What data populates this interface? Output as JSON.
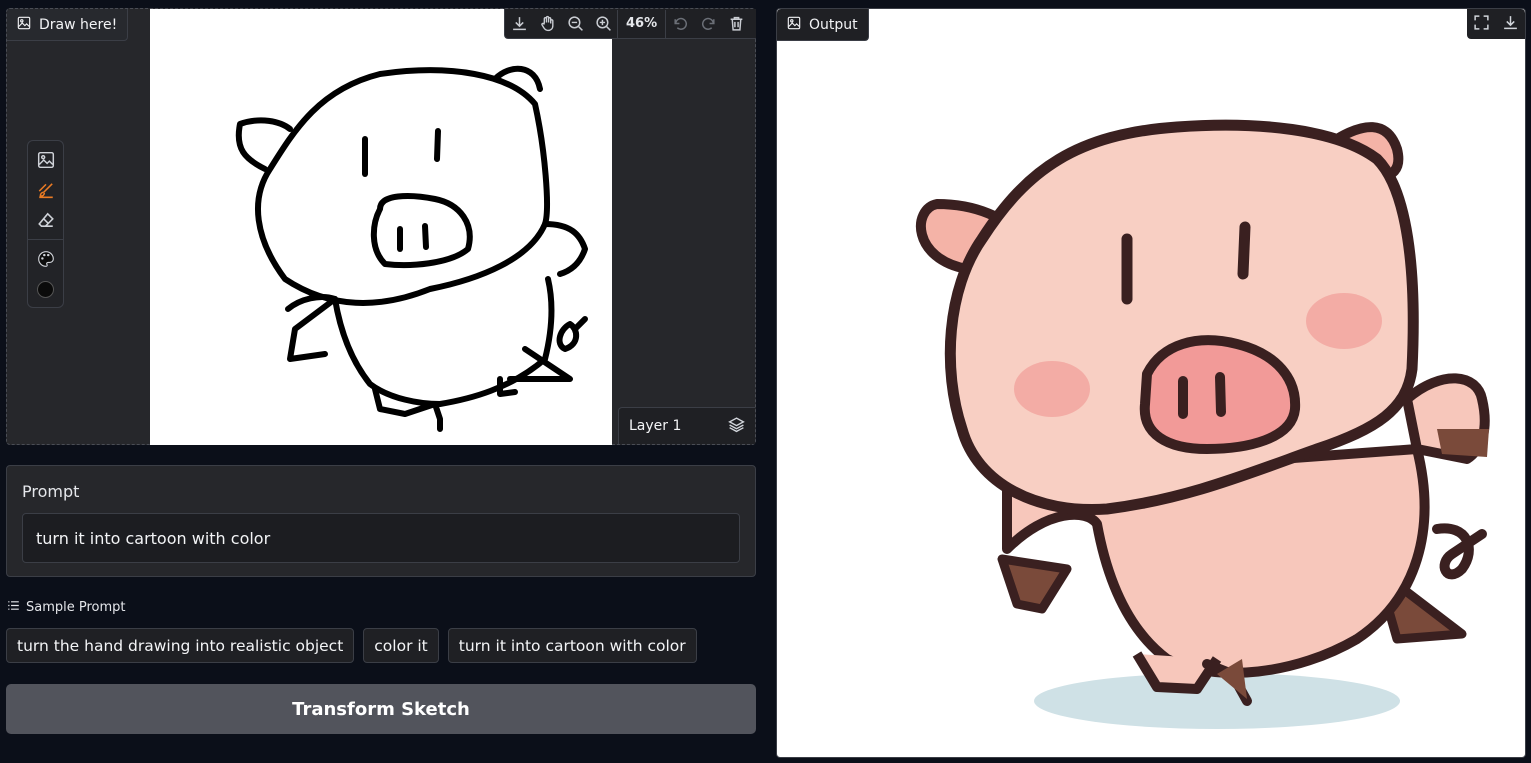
{
  "sketch_panel": {
    "label": "Draw here!",
    "zoom": "46%",
    "layer_label": "Layer 1",
    "toolbar_icons": [
      "download-icon",
      "pan-hand-icon",
      "zoom-out-icon",
      "zoom-in-icon",
      "undo-icon",
      "redo-icon",
      "trash-icon"
    ],
    "tools": [
      "image-icon",
      "brush-icon",
      "eraser-icon",
      "palette-icon",
      "brush-size-icon"
    ],
    "active_tool": "brush-icon",
    "brush_color": "#000000"
  },
  "prompt": {
    "label": "Prompt",
    "value": "turn it into cartoon with color"
  },
  "samples": {
    "label": "Sample Prompt",
    "items": [
      "turn the hand drawing into realistic object",
      "color it",
      "turn it into cartoon with color"
    ]
  },
  "action": {
    "transform_label": "Transform Sketch"
  },
  "output_panel": {
    "label": "Output",
    "toolbar_icons": [
      "fullscreen-icon",
      "download-icon"
    ]
  },
  "colors": {
    "background": "#0b0f19",
    "panel": "#1f2024",
    "accent": "#ea7b24",
    "button": "#52545c",
    "pig_pink": "#f8c9bd",
    "pig_outline": "#3a2020"
  }
}
